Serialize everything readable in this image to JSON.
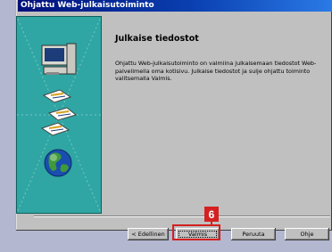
{
  "window": {
    "title": "Ohjattu Web-julkaisutoiminto"
  },
  "content": {
    "heading": "Julkaise tiedostot",
    "body": "Ohjattu Web-julkaisutoiminto on valmiina julkaisemaan tiedostot Web-palvelimella oma kotisivu. Julkaise tiedostot ja sulje ohjattu toiminto valitsemalla Valmis."
  },
  "buttons": {
    "back": "< Edellinen",
    "finish": "Valmis",
    "cancel": "Peruuta",
    "help": "Ohje"
  },
  "callout": {
    "step": "6"
  },
  "colors": {
    "title_bar": "#0a3fb0",
    "side_panel": "#2fa6a3",
    "highlight": "#d42020"
  }
}
